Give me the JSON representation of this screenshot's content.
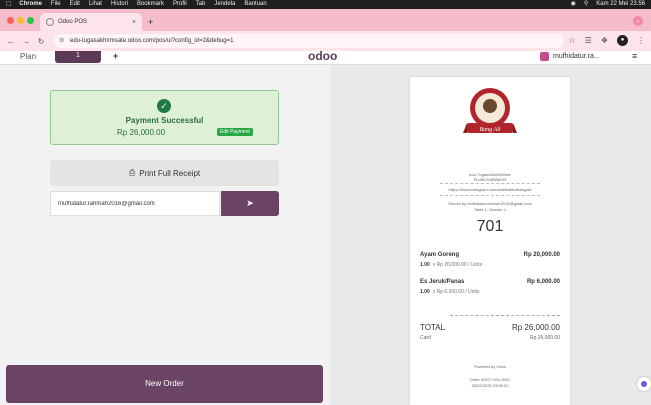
{
  "menubar": {
    "app": "Chrome",
    "items": [
      "File",
      "Edit",
      "Lihat",
      "Histori",
      "Bookmark",
      "Profil",
      "Tab",
      "Jendela",
      "Bantuan"
    ],
    "clock": "Kam 22 Mei 23.56"
  },
  "browser": {
    "tab_title": "Odoo POS",
    "url": "edu-tugasakhirmsate.odoo.com/pos/ui?config_id=2&debug=1"
  },
  "pos_header": {
    "plan_label": "Plan",
    "order_tab": "1",
    "add_label": "+",
    "brand": "odoo",
    "user": "mufhidatur.ra..."
  },
  "payment": {
    "title": "Payment Successful",
    "amount": "Rp 26,000.00",
    "edit_label": "Edit Payment",
    "print_label": "Print Full Receipt",
    "email_value": "mufhidatur.rahmah2016@gmail.com",
    "new_order_label": "New Order"
  },
  "receipt": {
    "logo_text": "Bang Ali",
    "company": "edu-TugasAkhirMsSate",
    "phone": "Tel:081328588105",
    "website": "https://www.instagram.com/satebaliibulbangali/",
    "served_by": "Served by mufhidatur.rahmah2016@gmail.com",
    "table": "Table 1, Guests: 1",
    "order_number": "701",
    "items": [
      {
        "name": "Ayam Goreng",
        "price": "Rp 20,000.00",
        "qty": "1.00",
        "unit": "x Rp 20,000.00 / Units"
      },
      {
        "name": "Es Jeruk/Panas",
        "price": "Rp 6,000.00",
        "qty": "1.00",
        "unit": "x Rp 6,000.00 / Units"
      }
    ],
    "total_label": "TOTAL",
    "total_value": "Rp 26,000.00",
    "payment_method": "Card",
    "payment_value": "Rp 26,000.00",
    "powered_by": "Powered by Odoo",
    "order_ref": "Order 00077-001-0001",
    "order_date": "05/22/2025 23:56:01"
  },
  "colors": {
    "brand_purple": "#6b4364",
    "success_green": "#28a745",
    "tab_pink": "#f5bccb"
  }
}
